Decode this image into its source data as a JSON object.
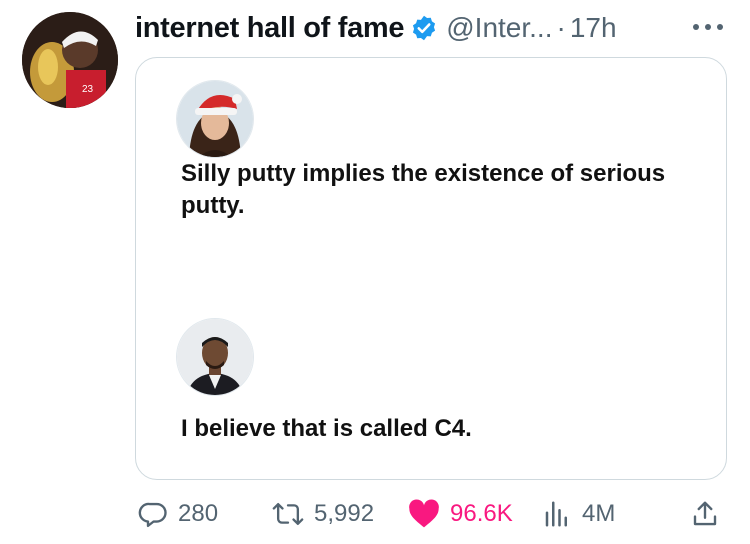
{
  "tweet": {
    "display_name": "internet hall of fame",
    "handle": "@Inter...",
    "separator": "·",
    "time": "17h",
    "avatar_icon": "profile-photo-basketball-player",
    "verified_icon": "verified-badge-icon",
    "verified_color": "#1d9bf0",
    "more_icon": "more-dots-icon"
  },
  "media": {
    "post1": {
      "avatar_icon": "woman-santa-hat-avatar",
      "text": "Silly putty implies the existence of serious putty."
    },
    "post2": {
      "avatar_icon": "man-suit-avatar",
      "text": "I believe that is called C4."
    }
  },
  "actions": {
    "replies": "280",
    "retweets": "5,992",
    "likes": "96.6K",
    "views": "4M",
    "like_color": "#f91880",
    "icon_color": "#536471"
  }
}
